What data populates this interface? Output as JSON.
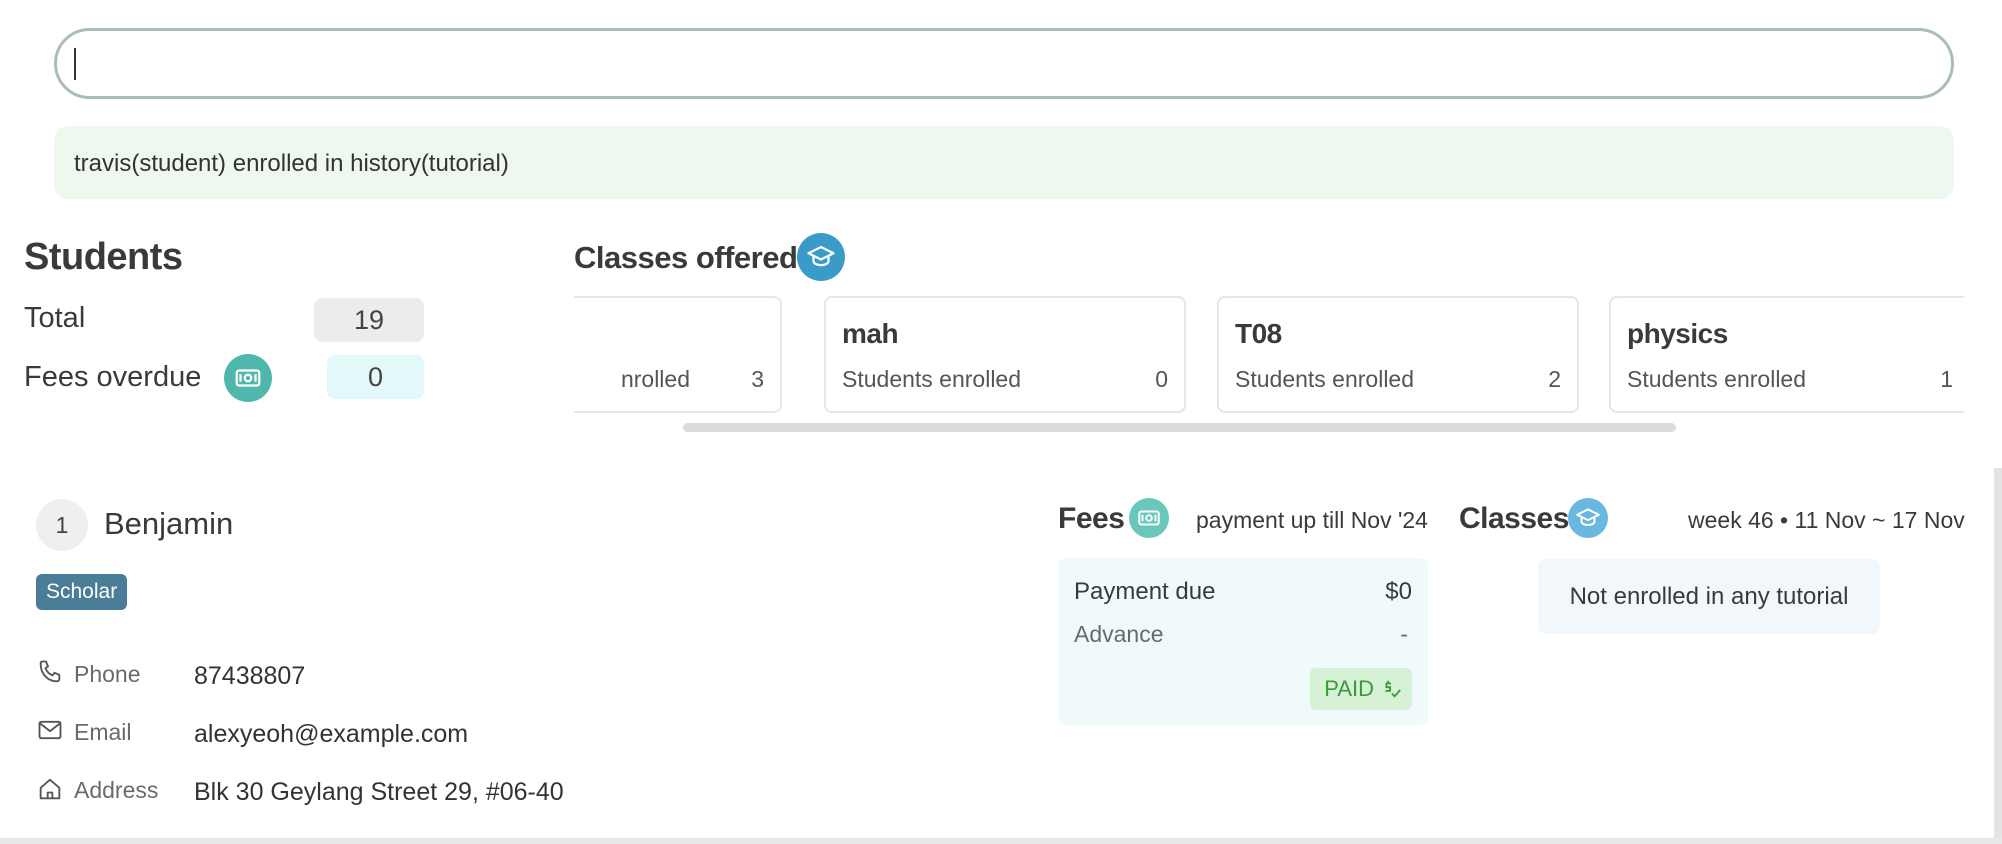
{
  "command": {
    "value": ""
  },
  "result": {
    "message": "travis(student) enrolled in history(tutorial)"
  },
  "students": {
    "title": "Students",
    "total_label": "Total",
    "total_value": "19",
    "fees_overdue_label": "Fees overdue",
    "fees_overdue_value": "0"
  },
  "classes_offered": {
    "title": "Classes offered",
    "cards": [
      {
        "name": "",
        "label": "nrolled",
        "count": "3"
      },
      {
        "name": "mah",
        "label": "Students enrolled",
        "count": "0"
      },
      {
        "name": "T08",
        "label": "Students enrolled",
        "count": "2"
      },
      {
        "name": "physics",
        "label": "Students enrolled",
        "count": "1"
      }
    ]
  },
  "person": {
    "index": "1",
    "name": "Benjamin",
    "tag": "Scholar",
    "phone_label": "Phone",
    "phone": "87438807",
    "email_label": "Email",
    "email": "alexyeoh@example.com",
    "address_label": "Address",
    "address": "Blk 30 Geylang Street 29, #06-40"
  },
  "fees": {
    "title": "Fees",
    "subtitle": "payment up till Nov '24",
    "payment_due_label": "Payment due",
    "payment_due_value": "$0",
    "advance_label": "Advance",
    "advance_value": "-",
    "status": "PAID"
  },
  "classes": {
    "title": "Classes",
    "week": "week 46 • 11 Nov ~ 17 Nov",
    "empty_message": "Not enrolled in any tutorial"
  },
  "icons": {
    "fees": "money-icon",
    "classes": "graduation-cap-icon",
    "phone": "phone-icon",
    "email": "envelope-icon",
    "address": "home-icon"
  },
  "colors": {
    "fees_accent": "#4fb7ab",
    "classes_accent": "#3a9ac8",
    "tag": "#4a7e98",
    "result_bg": "#eef8ee",
    "paid": "#3a9a3a"
  }
}
